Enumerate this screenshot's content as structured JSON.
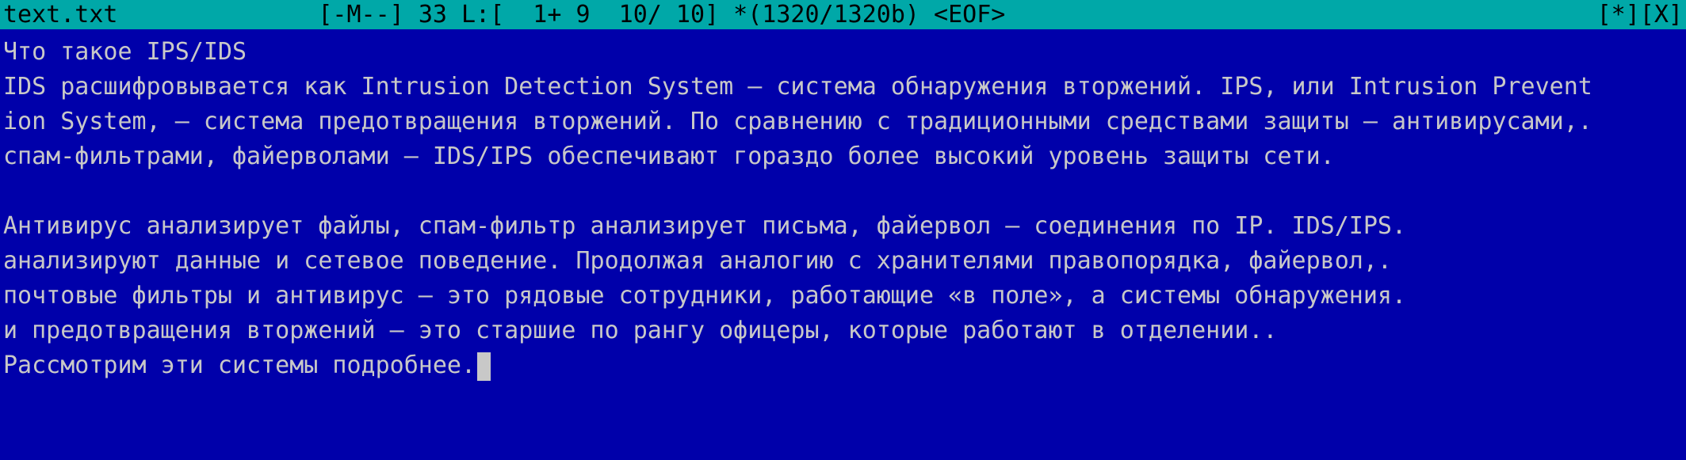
{
  "status": {
    "filename": "text.txt",
    "mode": "[-M--]",
    "char_code": "33",
    "line_info": "L:[  1+ 9  10/ 10]",
    "size_info": "*(1320/1320b)",
    "eof": "<EOF>",
    "right_controls": "[*][X]"
  },
  "text_lines": [
    "Что такое IPS/IDS",
    "IDS расшифровывается как Intrusion Detection System — система обнаружения вторжений. IPS, или Intrusion Prevent",
    "ion System, — система предотвращения вторжений. По сравнению с традиционными средствами защиты — антивирусами,.",
    "спам-фильтрами, файерволами — IDS/IPS обеспечивают гораздо более высокий уровень защиты сети.",
    "",
    "Антивирус анализирует файлы, спам-фильтр анализирует письма, файервол — соединения по IP. IDS/IPS.",
    "анализируют данные и сетевое поведение. Продолжая аналогию с хранителями правопорядка, файервол,.",
    "почтовые фильтры и антивирус — это рядовые сотрудники, работающие «в поле», а системы обнаружения.",
    "и предотвращения вторжений — это старшие по рангу офицеры, которые работают в отделении..",
    "Рассмотрим эти системы подробнее."
  ],
  "colors": {
    "background": "#0000aa",
    "statusbar": "#00a8a8",
    "text": "#c8c8c8"
  }
}
